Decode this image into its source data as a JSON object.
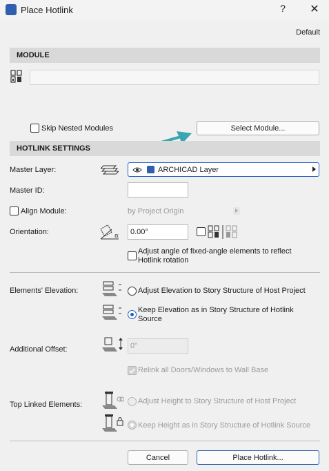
{
  "window": {
    "title": "Place Hotlink",
    "help_label": "?",
    "close_label": "✕",
    "app_icon": "archicad-app-icon"
  },
  "profile": "Default",
  "module": {
    "header": "MODULE",
    "path_value": "",
    "skip_nested_label": "Skip Nested Modules",
    "skip_nested_checked": false,
    "select_button": "Select Module..."
  },
  "hotlink": {
    "header": "HOTLINK SETTINGS",
    "master_layer_label": "Master Layer:",
    "layer_value": "ARCHICAD Layer",
    "master_id_label": "Master ID:",
    "master_id_value": "",
    "align_label": "Align Module:",
    "align_checked": false,
    "align_value": "by Project Origin",
    "orientation_label": "Orientation:",
    "orientation_value": "0.00°",
    "adjust_angle_label_1": "Adjust angle of fixed-angle elements to reflect",
    "adjust_angle_label_2": "Hotlink rotation"
  },
  "elevation": {
    "label": "Elements' Elevation:",
    "option_adjust": "Adjust Elevation to Story Structure of Host Project",
    "option_keep_1": "Keep Elevation as in Story Structure of Hotlink",
    "option_keep_2": "Source",
    "selected": "keep"
  },
  "offset": {
    "label": "Additional Offset:",
    "value": "0\"",
    "relink_label": "Relink all Doors/Windows to Wall Base"
  },
  "top_linked": {
    "label": "Top Linked Elements:",
    "option_adjust": "Adjust Height to Story Structure of Host Project",
    "option_keep": "Keep Height as in Story Structure of Hotlink Source"
  },
  "footer": {
    "cancel": "Cancel",
    "place": "Place Hotlink..."
  },
  "colors": {
    "accent": "#1f5fc8",
    "arrow": "#3aa6b0",
    "section_bg": "#d9d9d9"
  }
}
